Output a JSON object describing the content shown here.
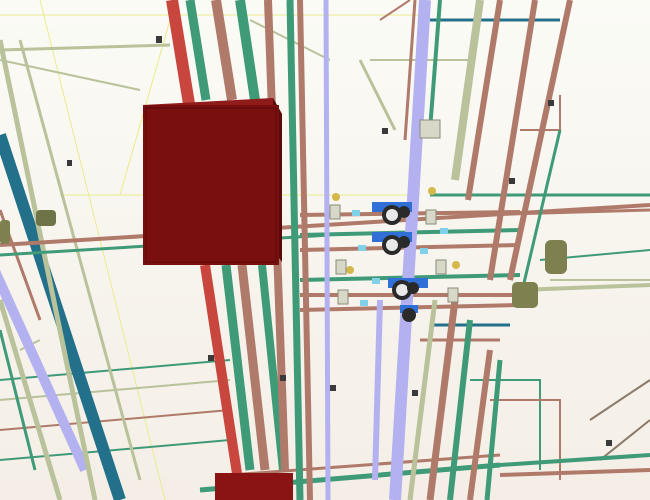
{
  "colors": {
    "background_top": "#fbfbf6",
    "background_bottom": "#f4eee6",
    "red_pipe": "#c8463e",
    "red_box": "#7a0f0f",
    "green_pipe": "#3f9a78",
    "teal_pipe": "#22708a",
    "copper_pipe": "#b07a6a",
    "sage_pipe": "#b9c29a",
    "lavender_pipe": "#b3b1ef",
    "blue_fitting": "#2f6fd6",
    "black_valve": "#2a2a2a",
    "olive_tank": "#7e8050"
  },
  "icons": [
    "pipe-network",
    "equipment-box",
    "pump-valve-assembly",
    "gauge"
  ]
}
